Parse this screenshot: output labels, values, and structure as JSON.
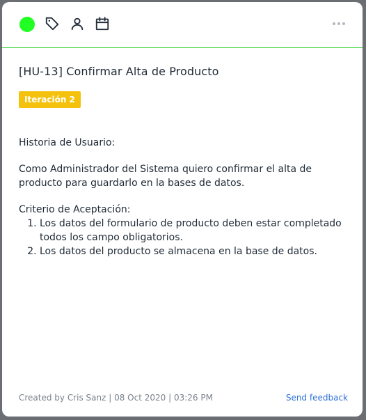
{
  "toolbar": {
    "status_color": "#22ff22",
    "icons": [
      "tag-icon",
      "person-icon",
      "calendar-icon"
    ],
    "more_icon": "more-horizontal-icon",
    "divider_color": "#39d43a"
  },
  "card": {
    "title": "[HU-13] Confirmar Alta de Producto",
    "badge": "Iteración 2",
    "badge_color": "#f4c20d",
    "body": {
      "heading": "Historia de Usuario:",
      "story": "Como Administrador del Sistema quiero confirmar el alta de producto para guardarlo en la bases de datos.",
      "criteria_heading": "Criterio de Aceptación:",
      "criteria": [
        "Los datos del formulario de producto deben estar completado todos los campo obligatorios.",
        "Los datos del producto se almacena en la base de datos."
      ]
    }
  },
  "footer": {
    "meta": "Created by Cris Sanz | 08 Oct 2020 | 03:26 PM",
    "feedback_link": "Send feedback",
    "link_color": "#2d6fd6"
  }
}
